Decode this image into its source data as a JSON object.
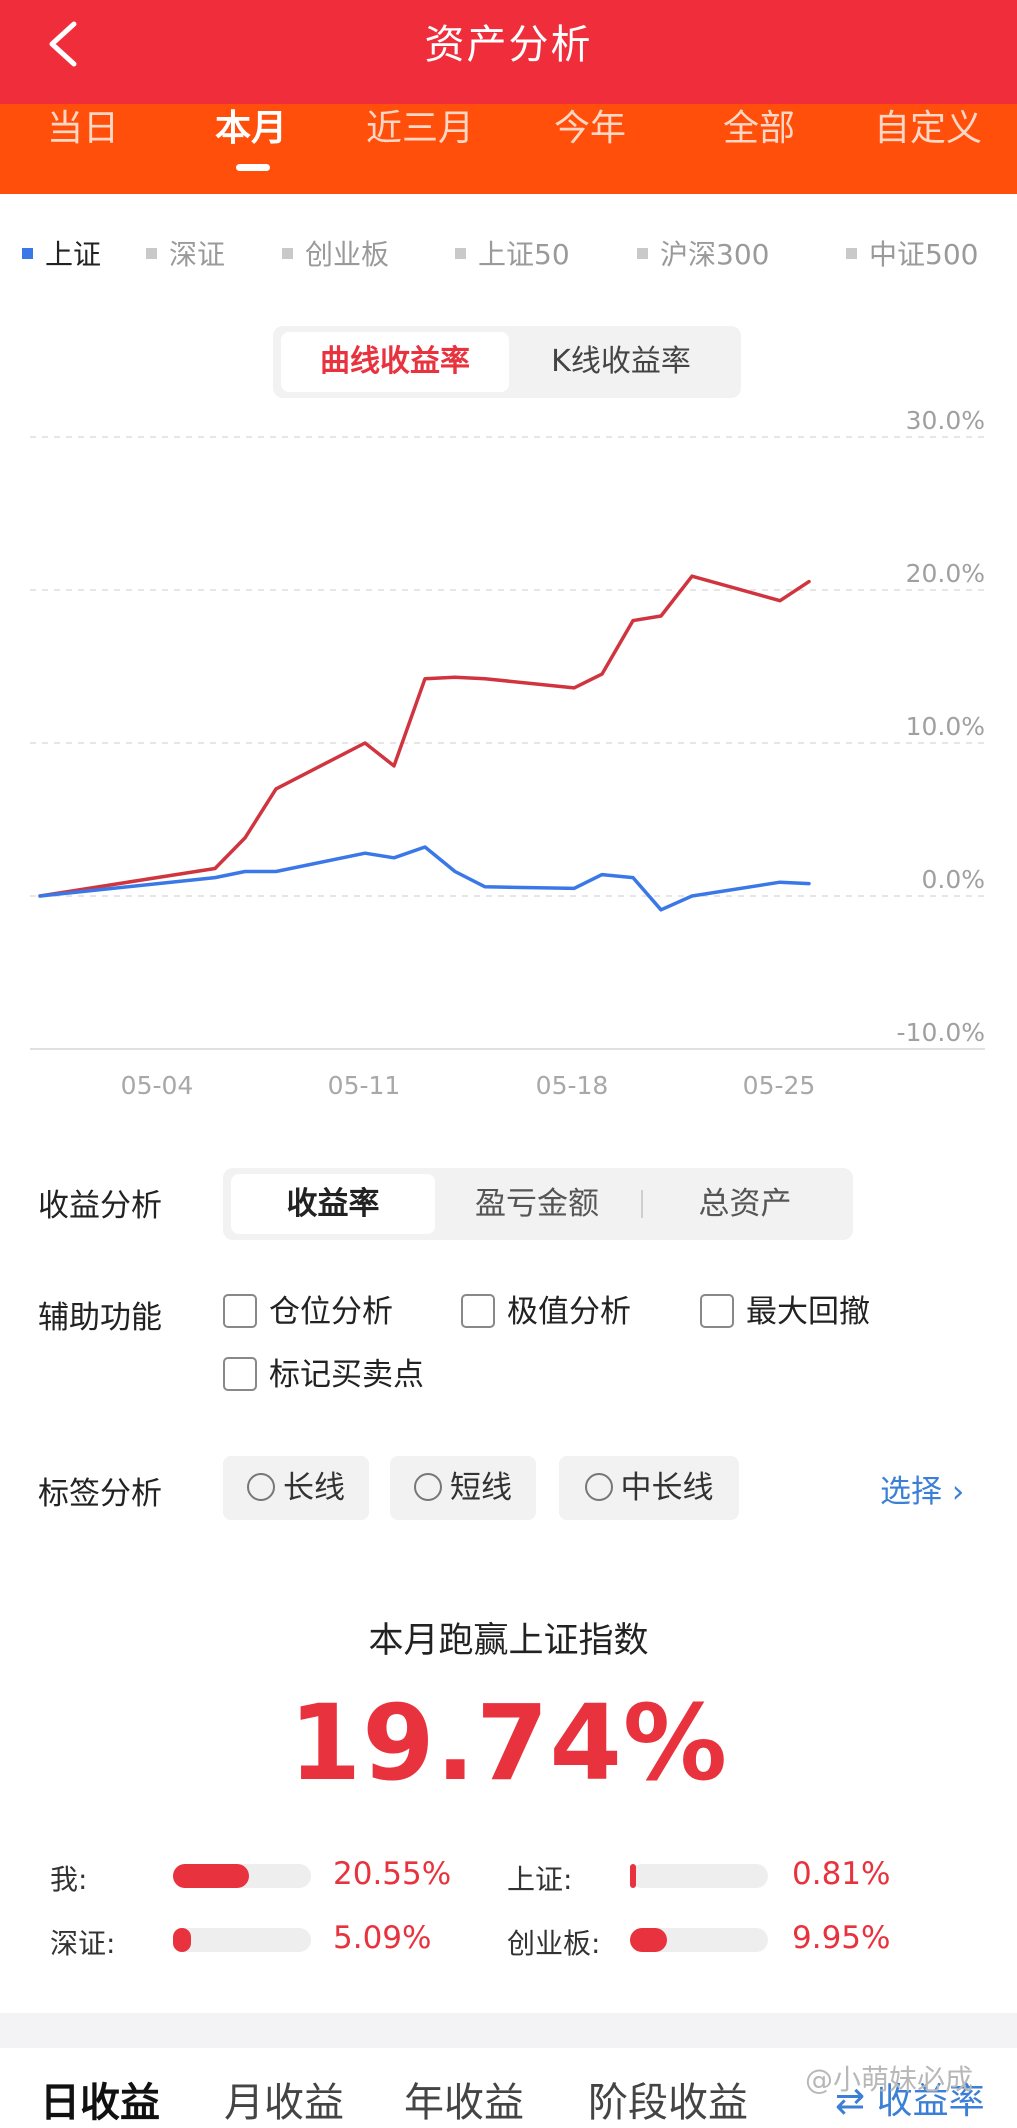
{
  "header": {
    "title": "资产分析",
    "back_icon": "chevron-left-icon"
  },
  "period_tabs": [
    {
      "label": "当日",
      "active": false
    },
    {
      "label": "本月",
      "active": true
    },
    {
      "label": "近三月",
      "active": false
    },
    {
      "label": "今年",
      "active": false
    },
    {
      "label": "全部",
      "active": false
    },
    {
      "label": "自定义",
      "active": false
    }
  ],
  "index_tabs": [
    {
      "label": "上证",
      "active": true
    },
    {
      "label": "深证",
      "active": false
    },
    {
      "label": "创业板",
      "active": false
    },
    {
      "label": "上证50",
      "active": false
    },
    {
      "label": "沪深300",
      "active": false
    },
    {
      "label": "中证500",
      "active": false
    }
  ],
  "chart_toggle": {
    "curve": "曲线收益率",
    "kline": "K线收益率",
    "active": "curve"
  },
  "chart_data": {
    "type": "line",
    "x_tick_labels": [
      "05-04",
      "05-11",
      "05-18",
      "05-25"
    ],
    "y_tick_labels": [
      "30.0%",
      "20.0%",
      "10.0%",
      "0.0%",
      "-10.0%"
    ],
    "ylim": [
      -10,
      30
    ],
    "grid": true,
    "series": [
      {
        "color": "#d0353f",
        "points": [
          [
            "04-30",
            0.0
          ],
          [
            "05-05",
            1.8
          ],
          [
            "05-06",
            3.8
          ],
          [
            "05-07",
            7.0
          ],
          [
            "05-10",
            10.0
          ],
          [
            "05-11",
            8.5
          ],
          [
            "05-12",
            14.2
          ],
          [
            "05-13",
            14.3
          ],
          [
            "05-14",
            14.2
          ],
          [
            "05-17",
            13.6
          ],
          [
            "05-18",
            14.5
          ],
          [
            "05-19",
            18.0
          ],
          [
            "05-20",
            18.3
          ],
          [
            "05-21",
            20.9
          ],
          [
            "05-24",
            19.3
          ],
          [
            "05-25",
            20.55
          ]
        ]
      },
      {
        "color": "#3b78e7",
        "points": [
          [
            "04-30",
            0.0
          ],
          [
            "05-05",
            1.2
          ],
          [
            "05-06",
            1.6
          ],
          [
            "05-07",
            1.6
          ],
          [
            "05-10",
            2.8
          ],
          [
            "05-11",
            2.5
          ],
          [
            "05-12",
            3.2
          ],
          [
            "05-13",
            1.6
          ],
          [
            "05-14",
            0.6
          ],
          [
            "05-17",
            0.5
          ],
          [
            "05-18",
            1.4
          ],
          [
            "05-19",
            1.2
          ],
          [
            "05-20",
            -0.9
          ],
          [
            "05-21",
            0.0
          ],
          [
            "05-24",
            0.9
          ],
          [
            "05-25",
            0.81
          ]
        ]
      }
    ]
  },
  "analysis": {
    "income_label": "收益分析",
    "income_tabs": [
      "收益率",
      "盈亏金额",
      "总资产"
    ],
    "aux_label": "辅助功能",
    "aux_options": [
      "仓位分析",
      "极值分析",
      "最大回撤",
      "标记买卖点"
    ],
    "tag_label": "标签分析",
    "tag_options": [
      "长线",
      "短线",
      "中长线"
    ],
    "choose": "选择 ›"
  },
  "summary": {
    "title": "本月跑赢上证指数",
    "value": "19.74%",
    "rows": [
      {
        "label": "我:",
        "value": "20.55%",
        "fill": 0.55
      },
      {
        "label": "上证:",
        "value": "0.81%",
        "fill": 0.02
      },
      {
        "label": "深证:",
        "value": "5.09%",
        "fill": 0.13
      },
      {
        "label": "创业板:",
        "value": "9.95%",
        "fill": 0.27
      }
    ]
  },
  "bottom_tabs": [
    "日收益",
    "月收益",
    "年收益",
    "阶段收益"
  ],
  "bottom_right_link": "⇄ 收益率",
  "watermark": "@小萌妹必成"
}
